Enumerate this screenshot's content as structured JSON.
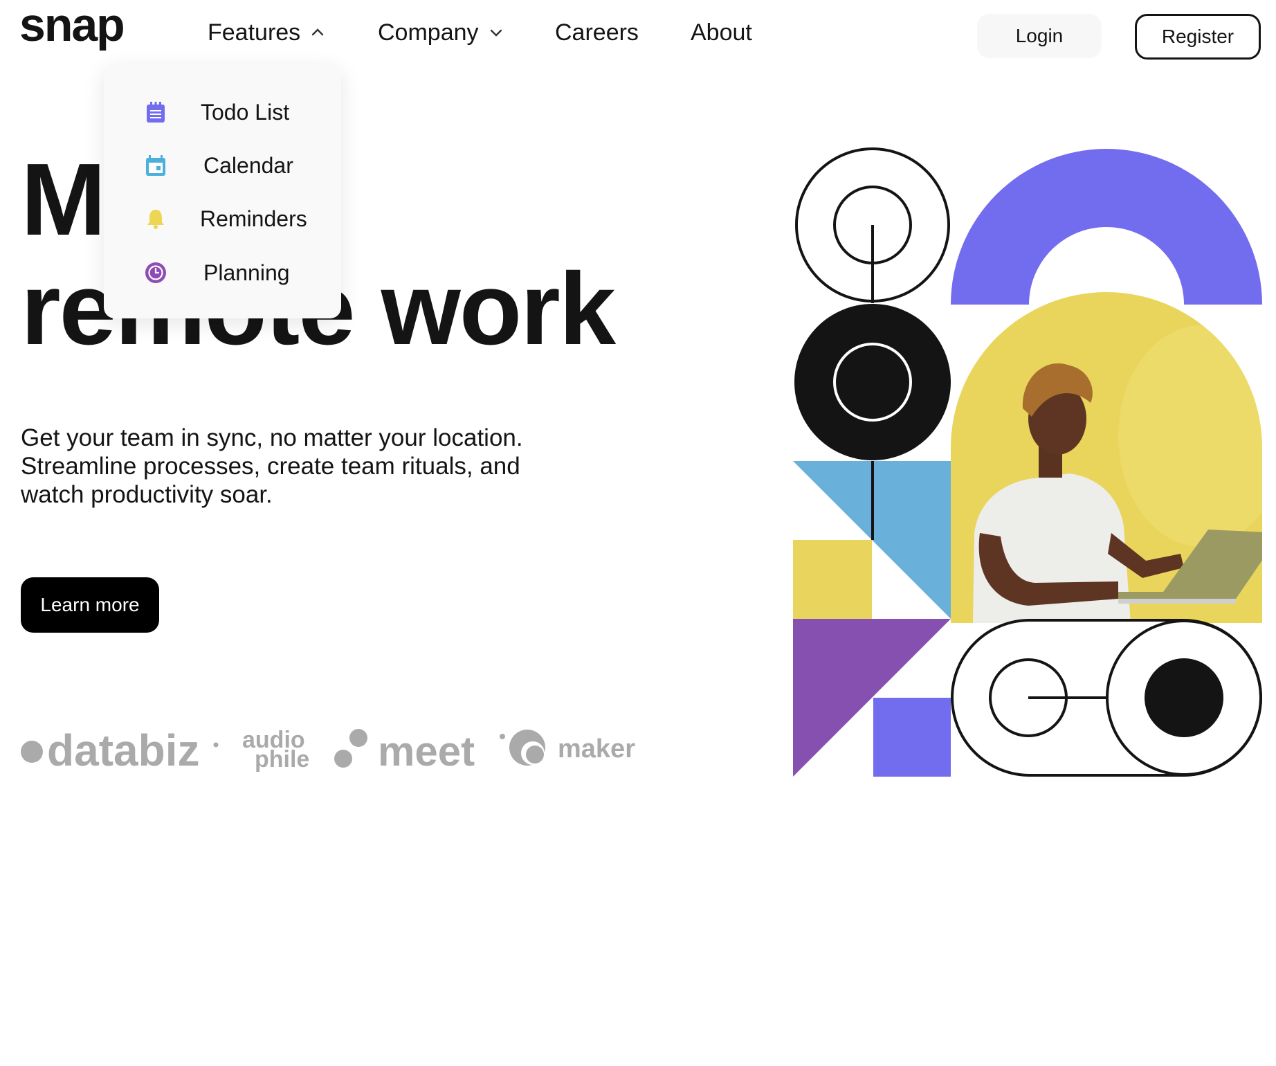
{
  "header": {
    "logo": "snap",
    "nav": [
      {
        "label": "Features",
        "expanded": true
      },
      {
        "label": "Company",
        "expanded": false
      },
      {
        "label": "Careers"
      },
      {
        "label": "About"
      }
    ],
    "login_label": "Login",
    "register_label": "Register"
  },
  "features_menu": {
    "items": [
      {
        "label": "Todo List",
        "icon": "todo-icon",
        "color": "#726CEE"
      },
      {
        "label": "Calendar",
        "icon": "calendar-icon",
        "color": "#4BB1DA"
      },
      {
        "label": "Reminders",
        "icon": "bell-icon",
        "color": "#EDD556"
      },
      {
        "label": "Planning",
        "icon": "clock-icon",
        "color": "#8E4CB6"
      }
    ]
  },
  "hero": {
    "title_line1": "Make",
    "title_line2": "remote work",
    "description": "Get your team in sync, no matter your location. Streamline processes, create team rituals, and watch productivity soar.",
    "cta_label": "Learn more"
  },
  "clients": {
    "logos": [
      "databiz",
      "audiophile",
      "meet",
      "maker"
    ],
    "color": "#aaaaaa"
  },
  "colors": {
    "purple": "#726CEE",
    "blue": "#69B0DA",
    "yellow": "#E9D55E",
    "violet": "#8650B0",
    "dark": "#141414"
  }
}
